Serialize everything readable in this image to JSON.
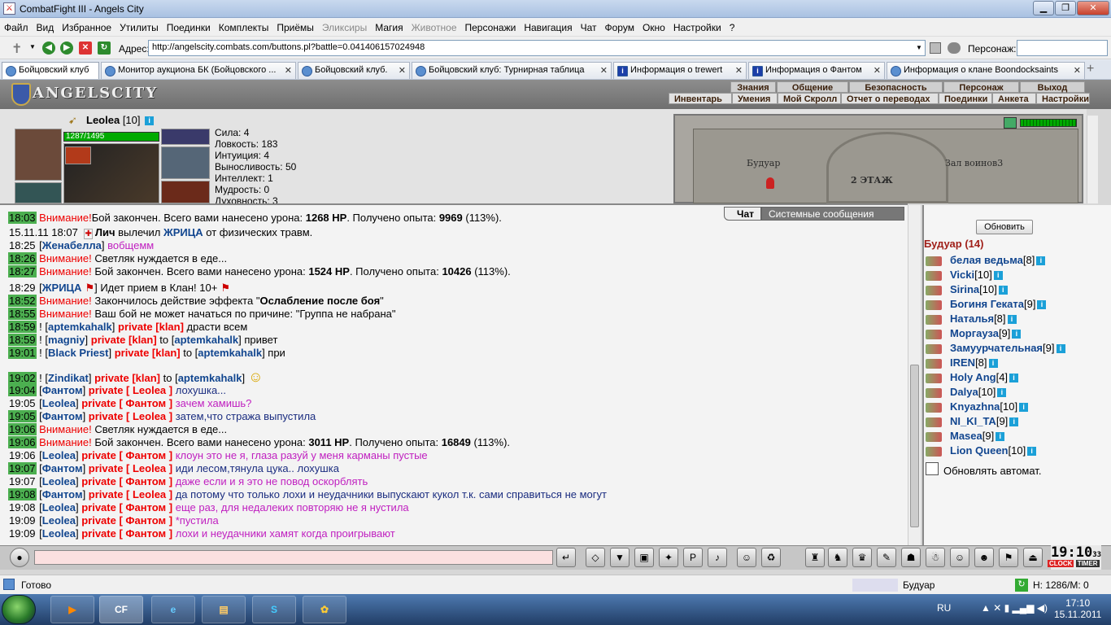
{
  "window": {
    "title": "CombatFight III - Angels City"
  },
  "menubar": [
    "Файл",
    "Вид",
    "Избранное",
    "Утилиты",
    "Поединки",
    "Комплекты",
    "Приёмы",
    "Эликсиры",
    "Магия",
    "Животное",
    "Персонажи",
    "Навигация",
    "Чат",
    "Форум",
    "Окно",
    "Настройки",
    "?"
  ],
  "menubar_disabled": [
    "Эликсиры",
    "Животное"
  ],
  "address": {
    "label": "Адрес:",
    "url": "http://angelscity.combats.com/buttons.pl?battle=0.041406157024948",
    "person_label": "Персонаж:"
  },
  "tabs": [
    {
      "label": "Бойцовский клуб",
      "icon": "sword-icon"
    },
    {
      "label": "Монитор аукциона БК (Бойцовского ...",
      "icon": "globe-icon"
    },
    {
      "label": "Бойцовский клуб.",
      "icon": "globe-icon"
    },
    {
      "label": "Бойцовский клуб: Турнирная таблица",
      "icon": "globe-icon"
    },
    {
      "label": "Информация о trewert",
      "icon": "info-icon"
    },
    {
      "label": "Информация о Фантом",
      "icon": "info-icon"
    },
    {
      "label": "Информация о клане Boondocksaints",
      "icon": "globe-icon"
    }
  ],
  "game_header": {
    "logo": "ANGELSCITY",
    "menu_top": [
      "Знания",
      "Общение",
      "Безопасность",
      "Персонаж",
      "Выход"
    ],
    "menu_bottom": [
      "Инвентарь",
      "Умения",
      "Мой Скролл",
      "Отчет о переводах",
      "Поединки",
      "Анкета",
      "Настройки"
    ]
  },
  "character": {
    "name": "Leolea",
    "level": "[10]",
    "hp": "1287/1495",
    "stats": [
      "Сила: 4",
      "Ловкость: 183",
      "Интуиция: 4",
      "Выносливость: 50",
      "Интеллект: 1",
      "Мудрость: 0",
      "Духовность: 3"
    ]
  },
  "map": {
    "room1": "Будуар",
    "room2": "Зал воинов3",
    "floor": "2 ЭТАЖ"
  },
  "chat_tabs": {
    "chat": "Чат",
    "system": "Системные сообщения"
  },
  "chat": [
    {
      "time": "18:03",
      "tg": true,
      "parts": [
        [
          "red",
          "Внимание!"
        ],
        [
          "",
          "Бой закончен. Всего вами нанесено урона: "
        ],
        [
          "b",
          "1268 HP"
        ],
        [
          "",
          ". Получено опыта: "
        ],
        [
          "b",
          "9969"
        ],
        [
          "",
          " (113%)."
        ]
      ]
    },
    {
      "time": "15.11.11 18:07",
      "tg": false,
      "parts": [
        [
          "b",
          "Лич"
        ],
        [
          "",
          " вылечил "
        ],
        [
          "blue",
          "ЖРИЦА"
        ],
        [
          "",
          " от физических травм."
        ]
      ]
    },
    {
      "time": "18:25",
      "tg": false,
      "parts": [
        [
          "",
          "["
        ],
        [
          "blue",
          "Женабелла"
        ],
        [
          "",
          "] "
        ],
        [
          "mag",
          "вобщемм"
        ]
      ]
    },
    {
      "time": "18:26",
      "tg": true,
      "parts": [
        [
          "red",
          "Внимание!"
        ],
        [
          "",
          " Светляк нуждается в еде..."
        ]
      ]
    },
    {
      "time": "18:27",
      "tg": true,
      "parts": [
        [
          "red",
          "Внимание!"
        ],
        [
          "",
          " Бой закончен. Всего вами нанесено урона: "
        ],
        [
          "b",
          "1524 HP"
        ],
        [
          "",
          ". Получено опыта: "
        ],
        [
          "b",
          "10426"
        ],
        [
          "",
          " (113%)."
        ]
      ]
    },
    {
      "time": "18:29",
      "tg": false,
      "parts": [
        [
          "",
          "["
        ],
        [
          "blue",
          "ЖРИЦА"
        ],
        [
          "",
          "]      Идет прием в Клан! 10+"
        ]
      ]
    },
    {
      "time": "18:52",
      "tg": true,
      "parts": [
        [
          "red",
          "Внимание!"
        ],
        [
          "",
          " Закончилось действие эффекта \""
        ],
        [
          "b",
          "Ослабление после боя"
        ],
        [
          "",
          "\""
        ]
      ]
    },
    {
      "time": "18:55",
      "tg": true,
      "parts": [
        [
          "red",
          "Внимание!"
        ],
        [
          "",
          " Ваш бой не может начаться по причине: \"Группа не набрана\""
        ]
      ]
    },
    {
      "time": "18:59",
      "tg": true,
      "parts": [
        [
          "",
          "! ["
        ],
        [
          "blue",
          "aptemkahalk"
        ],
        [
          "",
          "] "
        ],
        [
          "rb",
          "private [klan]"
        ],
        [
          "",
          " драсти всем"
        ]
      ]
    },
    {
      "time": "18:59",
      "tg": true,
      "parts": [
        [
          "",
          "! ["
        ],
        [
          "blue",
          "magniy"
        ],
        [
          "",
          "] "
        ],
        [
          "rb",
          "private [klan]"
        ],
        [
          "",
          " to ["
        ],
        [
          "blue",
          "aptemkahalk"
        ],
        [
          "",
          "] привет"
        ]
      ]
    },
    {
      "time": "19:01",
      "tg": true,
      "parts": [
        [
          "",
          "! ["
        ],
        [
          "blue",
          "Black Priest"
        ],
        [
          "",
          "] "
        ],
        [
          "rb",
          "private [klan]"
        ],
        [
          "",
          " to ["
        ],
        [
          "blue",
          "aptemkahalk"
        ],
        [
          "",
          "] при"
        ]
      ]
    },
    {
      "time": "19:02",
      "tg": true,
      "parts": [
        [
          "",
          "! ["
        ],
        [
          "blue",
          "Zindikat"
        ],
        [
          "",
          "] "
        ],
        [
          "rb",
          "private [klan]"
        ],
        [
          "",
          " to ["
        ],
        [
          "blue",
          "aptemkahalk"
        ],
        [
          "",
          "]"
        ]
      ]
    },
    {
      "time": "19:04",
      "tg": true,
      "parts": [
        [
          "",
          "["
        ],
        [
          "blue",
          "Фантом"
        ],
        [
          "",
          "] "
        ],
        [
          "rb",
          "private [ Leolea ]"
        ],
        [
          "navy",
          " лохушка..."
        ]
      ]
    },
    {
      "time": "19:05",
      "tg": false,
      "parts": [
        [
          "",
          "["
        ],
        [
          "blue",
          "Leolea"
        ],
        [
          "",
          "] "
        ],
        [
          "rb",
          "private [ Фантом ]"
        ],
        [
          "mag",
          " зачем хамишь?"
        ]
      ]
    },
    {
      "time": "19:05",
      "tg": true,
      "parts": [
        [
          "",
          "["
        ],
        [
          "blue",
          "Фантом"
        ],
        [
          "",
          "] "
        ],
        [
          "rb",
          "private [ Leolea ]"
        ],
        [
          "navy",
          " затем,что стража выпустила"
        ]
      ]
    },
    {
      "time": "19:06",
      "tg": true,
      "parts": [
        [
          "red",
          "Внимание!"
        ],
        [
          "",
          " Светляк нуждается в еде..."
        ]
      ]
    },
    {
      "time": "19:06",
      "tg": true,
      "parts": [
        [
          "red",
          "Внимание!"
        ],
        [
          "",
          " Бой закончен. Всего вами нанесено урона: "
        ],
        [
          "b",
          "3011 HP"
        ],
        [
          "",
          ". Получено опыта: "
        ],
        [
          "b",
          "16849"
        ],
        [
          "",
          " (113%)."
        ]
      ]
    },
    {
      "time": "19:06",
      "tg": false,
      "parts": [
        [
          "",
          "["
        ],
        [
          "blue",
          "Leolea"
        ],
        [
          "",
          "] "
        ],
        [
          "rb",
          "private [ Фантом ]"
        ],
        [
          "mag",
          " клоун это не я, глаза разуй у меня карманы пустые"
        ]
      ]
    },
    {
      "time": "19:07",
      "tg": true,
      "parts": [
        [
          "",
          "["
        ],
        [
          "blue",
          "Фантом"
        ],
        [
          "",
          "] "
        ],
        [
          "rb",
          "private [ Leolea ]"
        ],
        [
          "navy",
          " иди лесом,тянула цука.. лохушка"
        ]
      ]
    },
    {
      "time": "19:07",
      "tg": false,
      "parts": [
        [
          "",
          "["
        ],
        [
          "blue",
          "Leolea"
        ],
        [
          "",
          "] "
        ],
        [
          "rb",
          "private [ Фантом ]"
        ],
        [
          "mag",
          " даже если и я это не повод оскорблять"
        ]
      ]
    },
    {
      "time": "19:08",
      "tg": true,
      "parts": [
        [
          "",
          "["
        ],
        [
          "blue",
          "Фантом"
        ],
        [
          "",
          "] "
        ],
        [
          "rb",
          "private [ Leolea ]"
        ],
        [
          "navy",
          " да потому что только лохи и неудачники выпускают кукол т.к. сами справиться не могут"
        ]
      ]
    },
    {
      "time": "19:08",
      "tg": false,
      "parts": [
        [
          "",
          "["
        ],
        [
          "blue",
          "Leolea"
        ],
        [
          "",
          "] "
        ],
        [
          "rb",
          "private [ Фантом ]"
        ],
        [
          "mag",
          " еще раз, для недалеких повторяю не я нустила"
        ]
      ]
    },
    {
      "time": "19:09",
      "tg": false,
      "parts": [
        [
          "",
          "["
        ],
        [
          "blue",
          "Leolea"
        ],
        [
          "",
          "] "
        ],
        [
          "rb",
          "private [ Фантом ]"
        ],
        [
          "mag",
          " *пустила"
        ]
      ]
    },
    {
      "time": "19:09",
      "tg": false,
      "parts": [
        [
          "",
          "["
        ],
        [
          "blue",
          "Leolea"
        ],
        [
          "",
          "] "
        ],
        [
          "rb",
          "private [ Фантом ]"
        ],
        [
          "mag",
          " лохи и неудачники хамят когда проигрывают"
        ]
      ]
    }
  ],
  "online": {
    "refresh": "Обновить",
    "room": "Будуар (14)",
    "users": [
      {
        "name": "белая ведьма",
        "level": "[8]"
      },
      {
        "name": "Vicki",
        "level": "[10]"
      },
      {
        "name": "Sirina",
        "level": "[10]"
      },
      {
        "name": "Богиня Геката",
        "level": "[9]"
      },
      {
        "name": "Наталья",
        "level": "[8]"
      },
      {
        "name": "Моргауза",
        "level": "[9]"
      },
      {
        "name": "Замуурчательная",
        "level": "[9]"
      },
      {
        "name": "IREN",
        "level": "[8]"
      },
      {
        "name": "Holy Ang",
        "level": "[4]"
      },
      {
        "name": "Dalya",
        "level": "[10]"
      },
      {
        "name": "Knyazhna",
        "level": "[10]"
      },
      {
        "name": "NI_KI_TA",
        "level": "[9]"
      },
      {
        "name": "Masea",
        "level": "[9]"
      },
      {
        "name": "Lion Queen",
        "level": "[10]"
      }
    ],
    "auto": "Обновлять автомат."
  },
  "clock": {
    "time": "19:10",
    "seconds": "33",
    "clock_label": "CLOCK",
    "timer_label": "TIMER"
  },
  "status": {
    "ready": "Готово",
    "location": "Будуар",
    "hm": "Н: 1286/М: 0"
  },
  "taskbar": {
    "lang": "RU",
    "time": "17:10",
    "date": "15.11.2011"
  }
}
